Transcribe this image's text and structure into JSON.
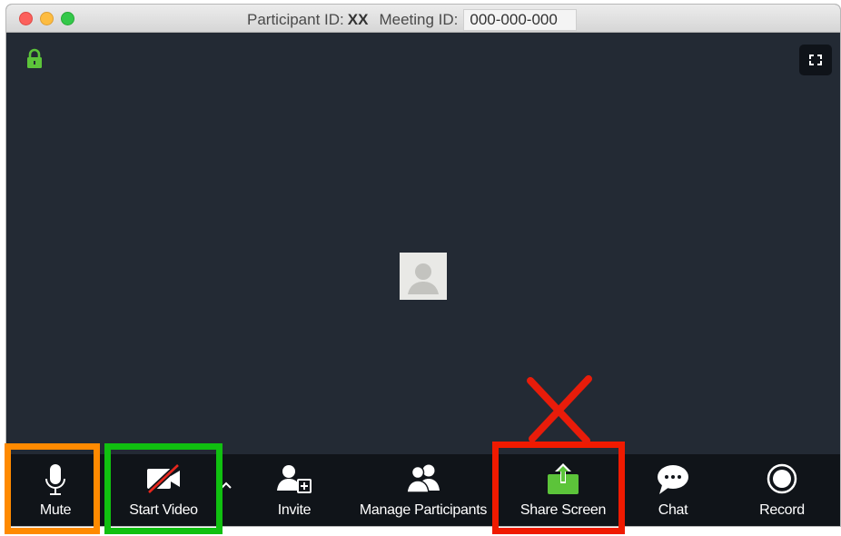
{
  "window": {
    "participant_label": "Participant ID:",
    "participant_value": "XX",
    "meeting_label": "Meeting ID:",
    "meeting_value": "000-000-000"
  },
  "toolbar": {
    "mute_label": "Mute",
    "start_video_label": "Start Video",
    "invite_label": "Invite",
    "manage_participants_label": "Manage Participants",
    "share_screen_label": "Share Screen",
    "chat_label": "Chat",
    "record_label": "Record"
  },
  "colors": {
    "background": "#232a34",
    "toolbar": "#101419",
    "lock_green": "#5cc43a",
    "share_green": "#5cc43a",
    "highlight_orange": "#ff8a00",
    "highlight_green": "#10c010",
    "highlight_red": "#f01a00"
  },
  "icons": [
    "lock-icon",
    "fullscreen-icon",
    "microphone-icon",
    "video-off-icon",
    "chevron-up-icon",
    "invite-icon",
    "participants-icon",
    "share-screen-icon",
    "chat-icon",
    "record-icon"
  ]
}
